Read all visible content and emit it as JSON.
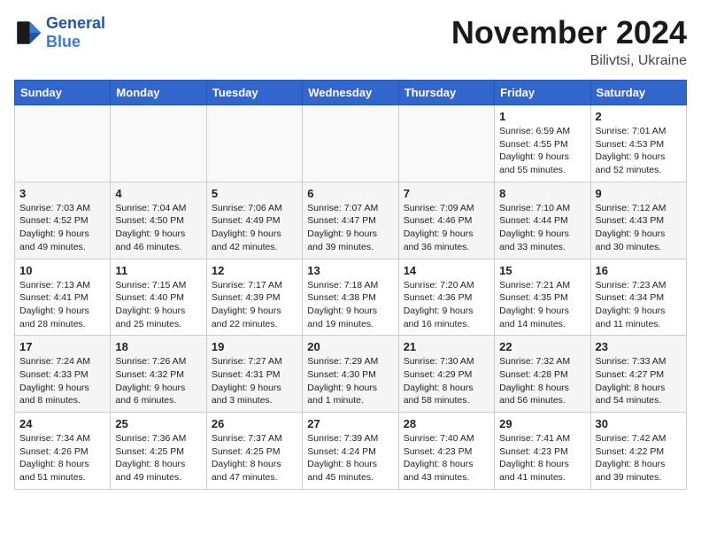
{
  "header": {
    "logo_line1": "General",
    "logo_line2": "Blue",
    "month_title": "November 2024",
    "location": "Bilivtsi, Ukraine"
  },
  "weekdays": [
    "Sunday",
    "Monday",
    "Tuesday",
    "Wednesday",
    "Thursday",
    "Friday",
    "Saturday"
  ],
  "weeks": [
    [
      {
        "day": "",
        "info": ""
      },
      {
        "day": "",
        "info": ""
      },
      {
        "day": "",
        "info": ""
      },
      {
        "day": "",
        "info": ""
      },
      {
        "day": "",
        "info": ""
      },
      {
        "day": "1",
        "info": "Sunrise: 6:59 AM\nSunset: 4:55 PM\nDaylight: 9 hours and 55 minutes."
      },
      {
        "day": "2",
        "info": "Sunrise: 7:01 AM\nSunset: 4:53 PM\nDaylight: 9 hours and 52 minutes."
      }
    ],
    [
      {
        "day": "3",
        "info": "Sunrise: 7:03 AM\nSunset: 4:52 PM\nDaylight: 9 hours and 49 minutes."
      },
      {
        "day": "4",
        "info": "Sunrise: 7:04 AM\nSunset: 4:50 PM\nDaylight: 9 hours and 46 minutes."
      },
      {
        "day": "5",
        "info": "Sunrise: 7:06 AM\nSunset: 4:49 PM\nDaylight: 9 hours and 42 minutes."
      },
      {
        "day": "6",
        "info": "Sunrise: 7:07 AM\nSunset: 4:47 PM\nDaylight: 9 hours and 39 minutes."
      },
      {
        "day": "7",
        "info": "Sunrise: 7:09 AM\nSunset: 4:46 PM\nDaylight: 9 hours and 36 minutes."
      },
      {
        "day": "8",
        "info": "Sunrise: 7:10 AM\nSunset: 4:44 PM\nDaylight: 9 hours and 33 minutes."
      },
      {
        "day": "9",
        "info": "Sunrise: 7:12 AM\nSunset: 4:43 PM\nDaylight: 9 hours and 30 minutes."
      }
    ],
    [
      {
        "day": "10",
        "info": "Sunrise: 7:13 AM\nSunset: 4:41 PM\nDaylight: 9 hours and 28 minutes."
      },
      {
        "day": "11",
        "info": "Sunrise: 7:15 AM\nSunset: 4:40 PM\nDaylight: 9 hours and 25 minutes."
      },
      {
        "day": "12",
        "info": "Sunrise: 7:17 AM\nSunset: 4:39 PM\nDaylight: 9 hours and 22 minutes."
      },
      {
        "day": "13",
        "info": "Sunrise: 7:18 AM\nSunset: 4:38 PM\nDaylight: 9 hours and 19 minutes."
      },
      {
        "day": "14",
        "info": "Sunrise: 7:20 AM\nSunset: 4:36 PM\nDaylight: 9 hours and 16 minutes."
      },
      {
        "day": "15",
        "info": "Sunrise: 7:21 AM\nSunset: 4:35 PM\nDaylight: 9 hours and 14 minutes."
      },
      {
        "day": "16",
        "info": "Sunrise: 7:23 AM\nSunset: 4:34 PM\nDaylight: 9 hours and 11 minutes."
      }
    ],
    [
      {
        "day": "17",
        "info": "Sunrise: 7:24 AM\nSunset: 4:33 PM\nDaylight: 9 hours and 8 minutes."
      },
      {
        "day": "18",
        "info": "Sunrise: 7:26 AM\nSunset: 4:32 PM\nDaylight: 9 hours and 6 minutes."
      },
      {
        "day": "19",
        "info": "Sunrise: 7:27 AM\nSunset: 4:31 PM\nDaylight: 9 hours and 3 minutes."
      },
      {
        "day": "20",
        "info": "Sunrise: 7:29 AM\nSunset: 4:30 PM\nDaylight: 9 hours and 1 minute."
      },
      {
        "day": "21",
        "info": "Sunrise: 7:30 AM\nSunset: 4:29 PM\nDaylight: 8 hours and 58 minutes."
      },
      {
        "day": "22",
        "info": "Sunrise: 7:32 AM\nSunset: 4:28 PM\nDaylight: 8 hours and 56 minutes."
      },
      {
        "day": "23",
        "info": "Sunrise: 7:33 AM\nSunset: 4:27 PM\nDaylight: 8 hours and 54 minutes."
      }
    ],
    [
      {
        "day": "24",
        "info": "Sunrise: 7:34 AM\nSunset: 4:26 PM\nDaylight: 8 hours and 51 minutes."
      },
      {
        "day": "25",
        "info": "Sunrise: 7:36 AM\nSunset: 4:25 PM\nDaylight: 8 hours and 49 minutes."
      },
      {
        "day": "26",
        "info": "Sunrise: 7:37 AM\nSunset: 4:25 PM\nDaylight: 8 hours and 47 minutes."
      },
      {
        "day": "27",
        "info": "Sunrise: 7:39 AM\nSunset: 4:24 PM\nDaylight: 8 hours and 45 minutes."
      },
      {
        "day": "28",
        "info": "Sunrise: 7:40 AM\nSunset: 4:23 PM\nDaylight: 8 hours and 43 minutes."
      },
      {
        "day": "29",
        "info": "Sunrise: 7:41 AM\nSunset: 4:23 PM\nDaylight: 8 hours and 41 minutes."
      },
      {
        "day": "30",
        "info": "Sunrise: 7:42 AM\nSunset: 4:22 PM\nDaylight: 8 hours and 39 minutes."
      }
    ]
  ]
}
